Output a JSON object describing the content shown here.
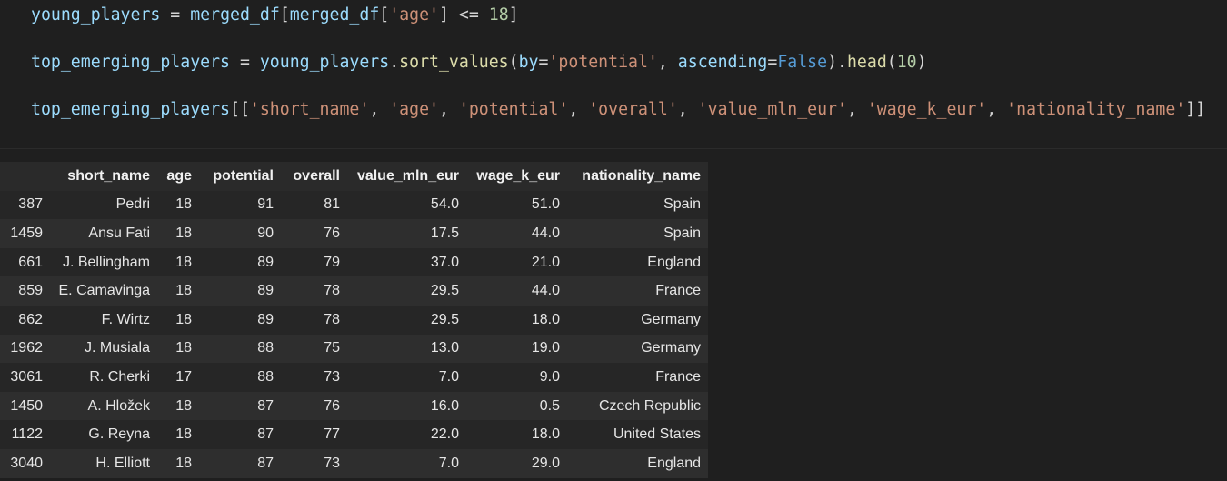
{
  "code": {
    "line1": {
      "var": "young_players",
      "eq": " = ",
      "obj": "merged_df",
      "open": "[",
      "obj2": "merged_df",
      "open2": "[",
      "key": "'age'",
      "close2": "]",
      "cmp": " <= ",
      "num": "18",
      "close": "]"
    },
    "line2": {
      "var": "top_emerging_players",
      "eq": " = ",
      "obj": "young_players",
      "dot": ".",
      "method": "sort_values",
      "open": "(",
      "param1": "by",
      "eq1": "=",
      "val1": "'potential'",
      "comma": ", ",
      "param2": "ascending",
      "eq2": "=",
      "val2": "False",
      "close": ")",
      "dot2": ".",
      "method2": "head",
      "open2": "(",
      "num": "10",
      "close2": ")"
    },
    "line3": {
      "var": "top_emerging_players",
      "open": "[[",
      "cols": [
        "'short_name'",
        "'age'",
        "'potential'",
        "'overall'",
        "'value_mln_eur'",
        "'wage_k_eur'",
        "'nationality_name'"
      ],
      "sep": ", ",
      "close": "]]"
    }
  },
  "table": {
    "columns": [
      "short_name",
      "age",
      "potential",
      "overall",
      "value_mln_eur",
      "wage_k_eur",
      "nationality_name"
    ],
    "rows": [
      {
        "index": "387",
        "cells": [
          "Pedri",
          "18",
          "91",
          "81",
          "54.0",
          "51.0",
          "Spain"
        ]
      },
      {
        "index": "1459",
        "cells": [
          "Ansu Fati",
          "18",
          "90",
          "76",
          "17.5",
          "44.0",
          "Spain"
        ]
      },
      {
        "index": "661",
        "cells": [
          "J. Bellingham",
          "18",
          "89",
          "79",
          "37.0",
          "21.0",
          "England"
        ]
      },
      {
        "index": "859",
        "cells": [
          "E. Camavinga",
          "18",
          "89",
          "78",
          "29.5",
          "44.0",
          "France"
        ]
      },
      {
        "index": "862",
        "cells": [
          "F. Wirtz",
          "18",
          "89",
          "78",
          "29.5",
          "18.0",
          "Germany"
        ]
      },
      {
        "index": "1962",
        "cells": [
          "J. Musiala",
          "18",
          "88",
          "75",
          "13.0",
          "19.0",
          "Germany"
        ]
      },
      {
        "index": "3061",
        "cells": [
          "R. Cherki",
          "17",
          "88",
          "73",
          "7.0",
          "9.0",
          "France"
        ]
      },
      {
        "index": "1450",
        "cells": [
          "A. Hložek",
          "18",
          "87",
          "76",
          "16.0",
          "0.5",
          "Czech Republic"
        ]
      },
      {
        "index": "1122",
        "cells": [
          "G. Reyna",
          "18",
          "87",
          "77",
          "22.0",
          "18.0",
          "United States"
        ]
      },
      {
        "index": "3040",
        "cells": [
          "H. Elliott",
          "18",
          "87",
          "73",
          "7.0",
          "29.0",
          "England"
        ]
      }
    ]
  }
}
